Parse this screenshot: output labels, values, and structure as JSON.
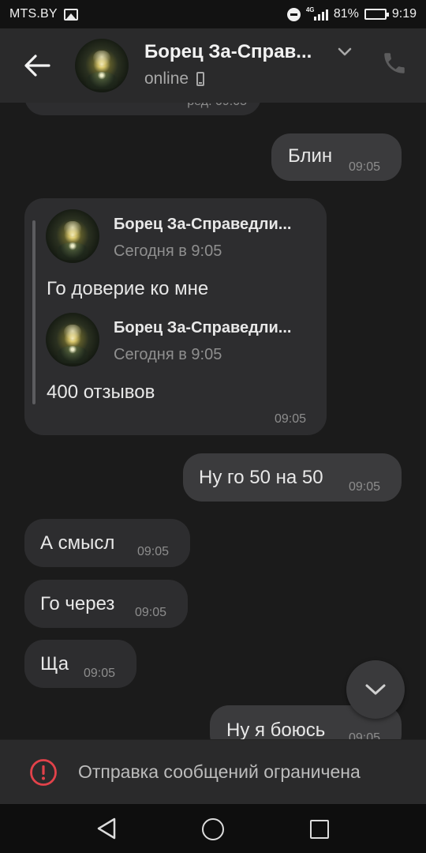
{
  "status_bar": {
    "carrier": "MTS.BY",
    "network": "4G",
    "battery": "81%",
    "battery_level": 0.81,
    "time": "9:19",
    "icons": [
      "image-icon",
      "dnd-icon",
      "signal-icon",
      "battery-icon"
    ]
  },
  "header": {
    "contact_name": "Борец За-Справ...",
    "status": "online",
    "icons": [
      "back-arrow-icon",
      "avatar",
      "chevron-down-icon",
      "phone-icon"
    ]
  },
  "messages": [
    {
      "id": "partial-top",
      "direction": "in",
      "text": "",
      "time": "ред. 09:05"
    },
    {
      "id": "m1",
      "direction": "out",
      "text": "Блин",
      "time": "09:05"
    },
    {
      "id": "m2",
      "direction": "in",
      "time": "09:05",
      "forwarded": [
        {
          "name": "Борец За-Справедли...",
          "date": "Сегодня в 9:05",
          "text": "Го доверие ко мне"
        },
        {
          "name": "Борец За-Справедли...",
          "date": "Сегодня в 9:05",
          "text": "400 отзывов"
        }
      ]
    },
    {
      "id": "m3",
      "direction": "out",
      "text": "Ну го 50 на 50",
      "time": "09:05"
    },
    {
      "id": "m4",
      "direction": "in",
      "text": "А смысл",
      "time": "09:05"
    },
    {
      "id": "m5",
      "direction": "in",
      "text": "Го через",
      "time": "09:05"
    },
    {
      "id": "m6",
      "direction": "in",
      "text": "Ща",
      "time": "09:05"
    },
    {
      "id": "m7",
      "direction": "out",
      "text": "Ну я боюсь",
      "time": "09:05"
    }
  ],
  "restriction": {
    "text": "Отправка сообщений ограничена",
    "icon": "alert-circle-icon",
    "color": "#e2424a"
  },
  "nav": {
    "icons": [
      "nav-back-icon",
      "nav-home-icon",
      "nav-recents-icon"
    ]
  },
  "colors": {
    "background": "#1b1b1b",
    "header": "#2a2a2b",
    "bubble_in": "#2d2d2f",
    "bubble_out": "#3b3b3d",
    "accent_alert": "#e2424a"
  }
}
